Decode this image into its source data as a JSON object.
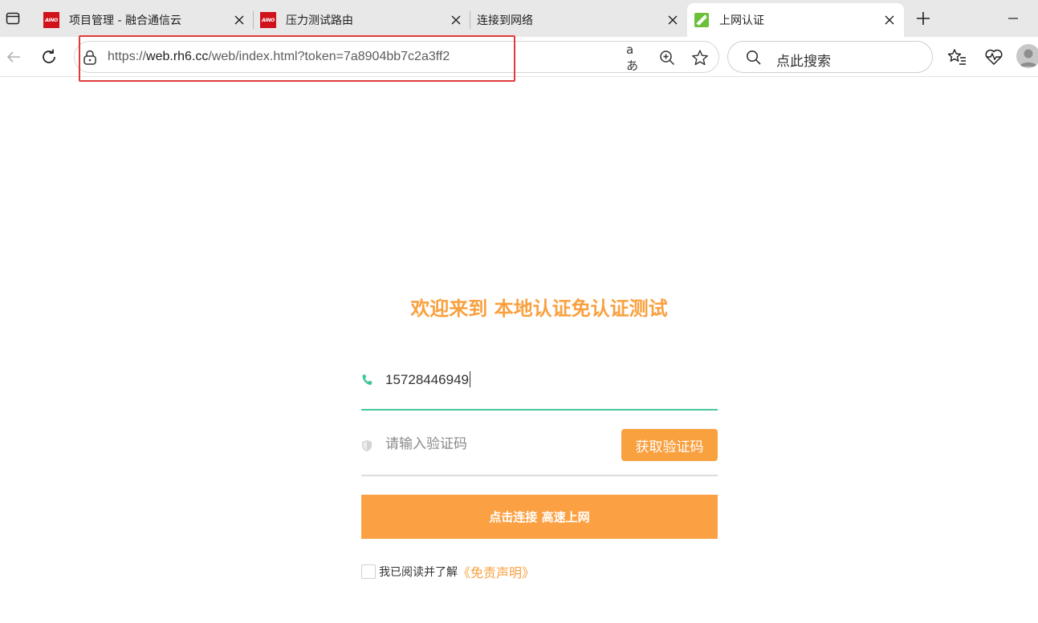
{
  "tabs": [
    {
      "title": "项目管理 - 融合通信云",
      "favicon": "aino-logo",
      "favicon_text": "AINO"
    },
    {
      "title": "压力测试路由",
      "favicon": "aino-logo",
      "favicon_text": "AINO"
    },
    {
      "title": "连接到网络",
      "favicon": "none"
    },
    {
      "title": "上网认证",
      "favicon": "green-leaf-logo",
      "active": true
    }
  ],
  "addressbar": {
    "url_prefix": "https://",
    "url_host": "web.rh6.cc",
    "url_path": "/web/index.html?token=7a8904bb7c2a3ff2",
    "read_aloud_label": "aあ"
  },
  "search": {
    "placeholder": "点此搜索"
  },
  "page": {
    "welcome": "欢迎来到 本地认证免认证测试",
    "phone_value": "15728446949",
    "code_placeholder": "请输入验证码",
    "get_code_label": "获取验证码",
    "connect_label": "点击连接 高速上网",
    "agree_text": "我已阅读并了解",
    "disclaimer_link": "《免责声明》"
  },
  "colors": {
    "accent_orange": "#f9a03f",
    "accent_green": "#4ac8a0",
    "highlight_red": "#e03a3a"
  }
}
